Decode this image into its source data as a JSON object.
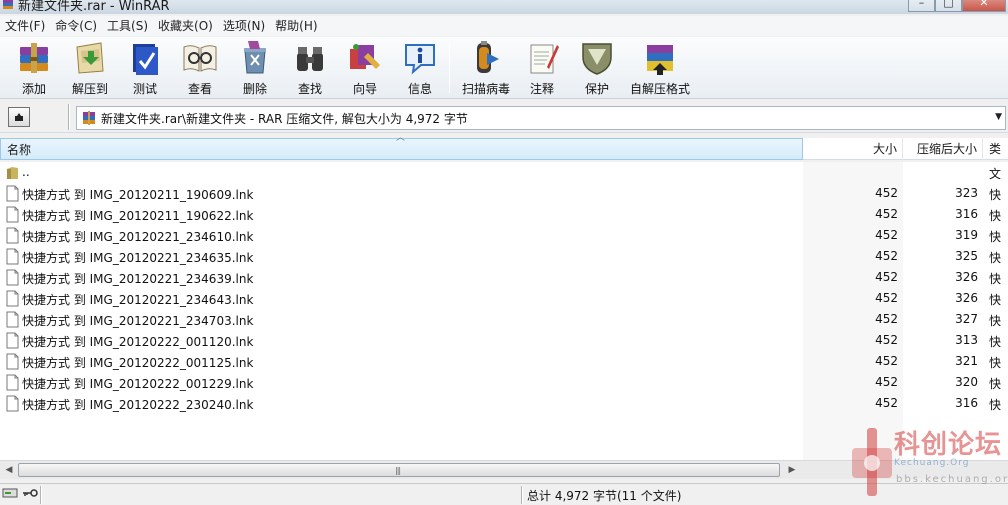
{
  "window": {
    "title": "新建文件夹.rar - WinRAR",
    "controls": {
      "minimize": "–",
      "maximize": "□",
      "close": "✕"
    }
  },
  "menu": [
    {
      "label": "文件(F)"
    },
    {
      "label": "命令(C)"
    },
    {
      "label": "工具(S)"
    },
    {
      "label": "收藏夹(O)"
    },
    {
      "label": "选项(N)"
    },
    {
      "label": "帮助(H)"
    }
  ],
  "toolbar": [
    {
      "label": "添加",
      "icon": "add-icon"
    },
    {
      "label": "解压到",
      "icon": "extract-to-icon"
    },
    {
      "label": "测试",
      "icon": "test-icon"
    },
    {
      "label": "查看",
      "icon": "view-icon"
    },
    {
      "label": "删除",
      "icon": "delete-icon"
    },
    {
      "label": "查找",
      "icon": "find-icon"
    },
    {
      "label": "向导",
      "icon": "wizard-icon"
    },
    {
      "label": "信息",
      "icon": "info-icon"
    },
    {
      "label": "扫描病毒",
      "icon": "virus-scan-icon"
    },
    {
      "label": "注释",
      "icon": "comment-icon"
    },
    {
      "label": "保护",
      "icon": "protect-icon"
    },
    {
      "label": "自解压格式",
      "icon": "sfx-icon"
    }
  ],
  "address": {
    "path": "新建文件夹.rar\\新建文件夹 - RAR 压缩文件, 解包大小为 4,972 字节"
  },
  "columns": {
    "name": "名称",
    "size": "大小",
    "packed": "压缩后大小",
    "type": "类"
  },
  "parent_row": {
    "name": "..",
    "type": "文"
  },
  "files": [
    {
      "name": "快捷方式 到 IMG_20120211_190609.lnk",
      "size": "452",
      "packed": "323",
      "type": "快"
    },
    {
      "name": "快捷方式 到 IMG_20120211_190622.lnk",
      "size": "452",
      "packed": "316",
      "type": "快"
    },
    {
      "name": "快捷方式 到 IMG_20120221_234610.lnk",
      "size": "452",
      "packed": "319",
      "type": "快"
    },
    {
      "name": "快捷方式 到 IMG_20120221_234635.lnk",
      "size": "452",
      "packed": "325",
      "type": "快"
    },
    {
      "name": "快捷方式 到 IMG_20120221_234639.lnk",
      "size": "452",
      "packed": "326",
      "type": "快"
    },
    {
      "name": "快捷方式 到 IMG_20120221_234643.lnk",
      "size": "452",
      "packed": "326",
      "type": "快"
    },
    {
      "name": "快捷方式 到 IMG_20120221_234703.lnk",
      "size": "452",
      "packed": "327",
      "type": "快"
    },
    {
      "name": "快捷方式 到 IMG_20120222_001120.lnk",
      "size": "452",
      "packed": "313",
      "type": "快"
    },
    {
      "name": "快捷方式 到 IMG_20120222_001125.lnk",
      "size": "452",
      "packed": "321",
      "type": "快"
    },
    {
      "name": "快捷方式 到 IMG_20120222_001229.lnk",
      "size": "452",
      "packed": "320",
      "type": "快"
    },
    {
      "name": "快捷方式 到 IMG_20120222_230240.lnk",
      "size": "452",
      "packed": "316",
      "type": "快"
    }
  ],
  "status": {
    "text": "总计 4,972 字节(11 个文件)"
  },
  "watermark": {
    "title": "科创论坛",
    "subtitle": "Kechuang.Org",
    "url": "bbs.kechuang.org"
  },
  "colors": {
    "header_highlight": "#d6ebfa",
    "watermark_red": "#d23c3c"
  }
}
